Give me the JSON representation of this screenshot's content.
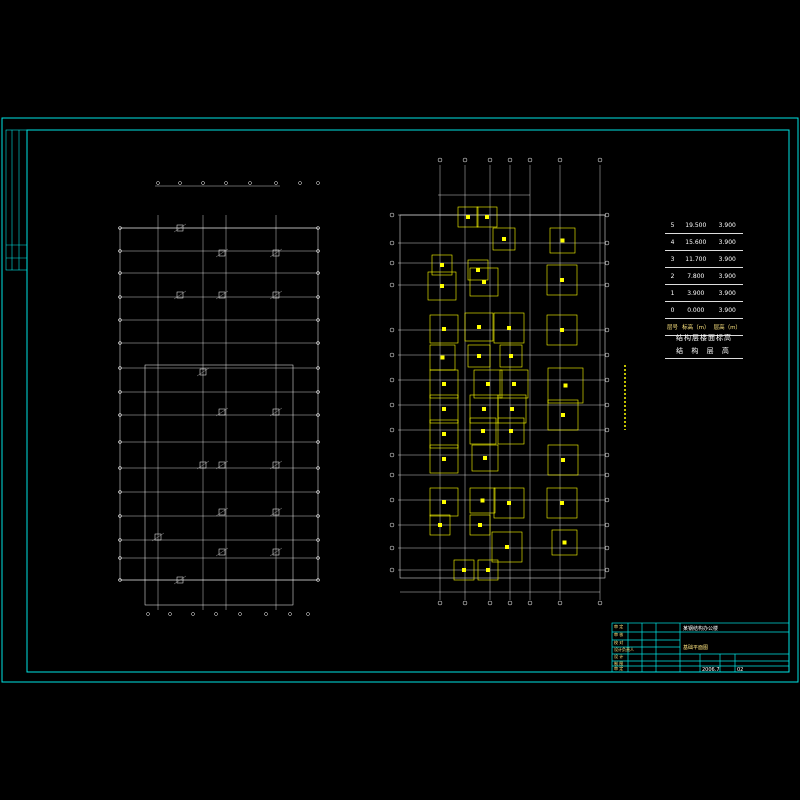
{
  "level_table": {
    "rows": [
      {
        "floor": "5",
        "elev": "19.500",
        "height": "3.900"
      },
      {
        "floor": "4",
        "elev": "15.600",
        "height": "3.900"
      },
      {
        "floor": "3",
        "elev": "11.700",
        "height": "3.900"
      },
      {
        "floor": "2",
        "elev": "7.800",
        "height": "3.900"
      },
      {
        "floor": "1",
        "elev": "3.900",
        "height": "3.900"
      },
      {
        "floor": "0",
        "elev": "0.000",
        "height": "3.900"
      }
    ],
    "header": {
      "floor": "层号",
      "elev": "标高（m）",
      "height": "层高（m）"
    },
    "title": "结构层楼面标高",
    "subtitle": "结 构 层 高"
  },
  "title_block": {
    "project": "某钢结构办公楼",
    "drawing": "基础平面图",
    "date": "2006.7",
    "sheet_no": "02",
    "row_labels": [
      "审 定",
      "审 核",
      "校 对",
      "设计负责人",
      "设 计",
      "制 图",
      "审 定"
    ]
  },
  "colors": {
    "frame": "#00e5e5",
    "accent": "#ffff00",
    "grid": "#ffffff",
    "dim": "#bbbbbb"
  }
}
